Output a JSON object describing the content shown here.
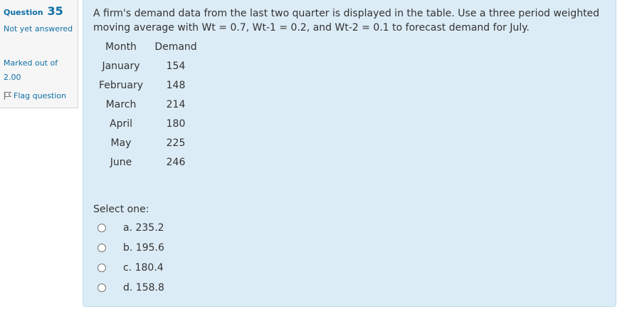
{
  "info": {
    "question_label": "Question",
    "question_number": "35",
    "state": "Not yet answered",
    "grade": "Marked out of 2.00",
    "flag_label": "Flag question"
  },
  "question": {
    "text": "A firm's demand data from the last two quarter is displayed in the table. Use a three period weighted moving average with Wt = 0.7, Wt-1 = 0.2, and Wt-2 = 0.1 to forecast demand for July.",
    "table": {
      "headers": [
        "Month",
        "Demand"
      ],
      "rows": [
        [
          "January",
          "154"
        ],
        [
          "February",
          "148"
        ],
        [
          "March",
          "214"
        ],
        [
          "April",
          "180"
        ],
        [
          "May",
          "225"
        ],
        [
          "June",
          "246"
        ]
      ]
    },
    "prompt": "Select one:",
    "options": [
      {
        "label": "a. 235.2"
      },
      {
        "label": "b. 195.6"
      },
      {
        "label": "c. 180.4"
      },
      {
        "label": "d. 158.8"
      }
    ]
  },
  "colors": {
    "accent": "#0f6fa5",
    "panel_bg": "#dcecf6",
    "info_bg": "#f6f6f6"
  }
}
